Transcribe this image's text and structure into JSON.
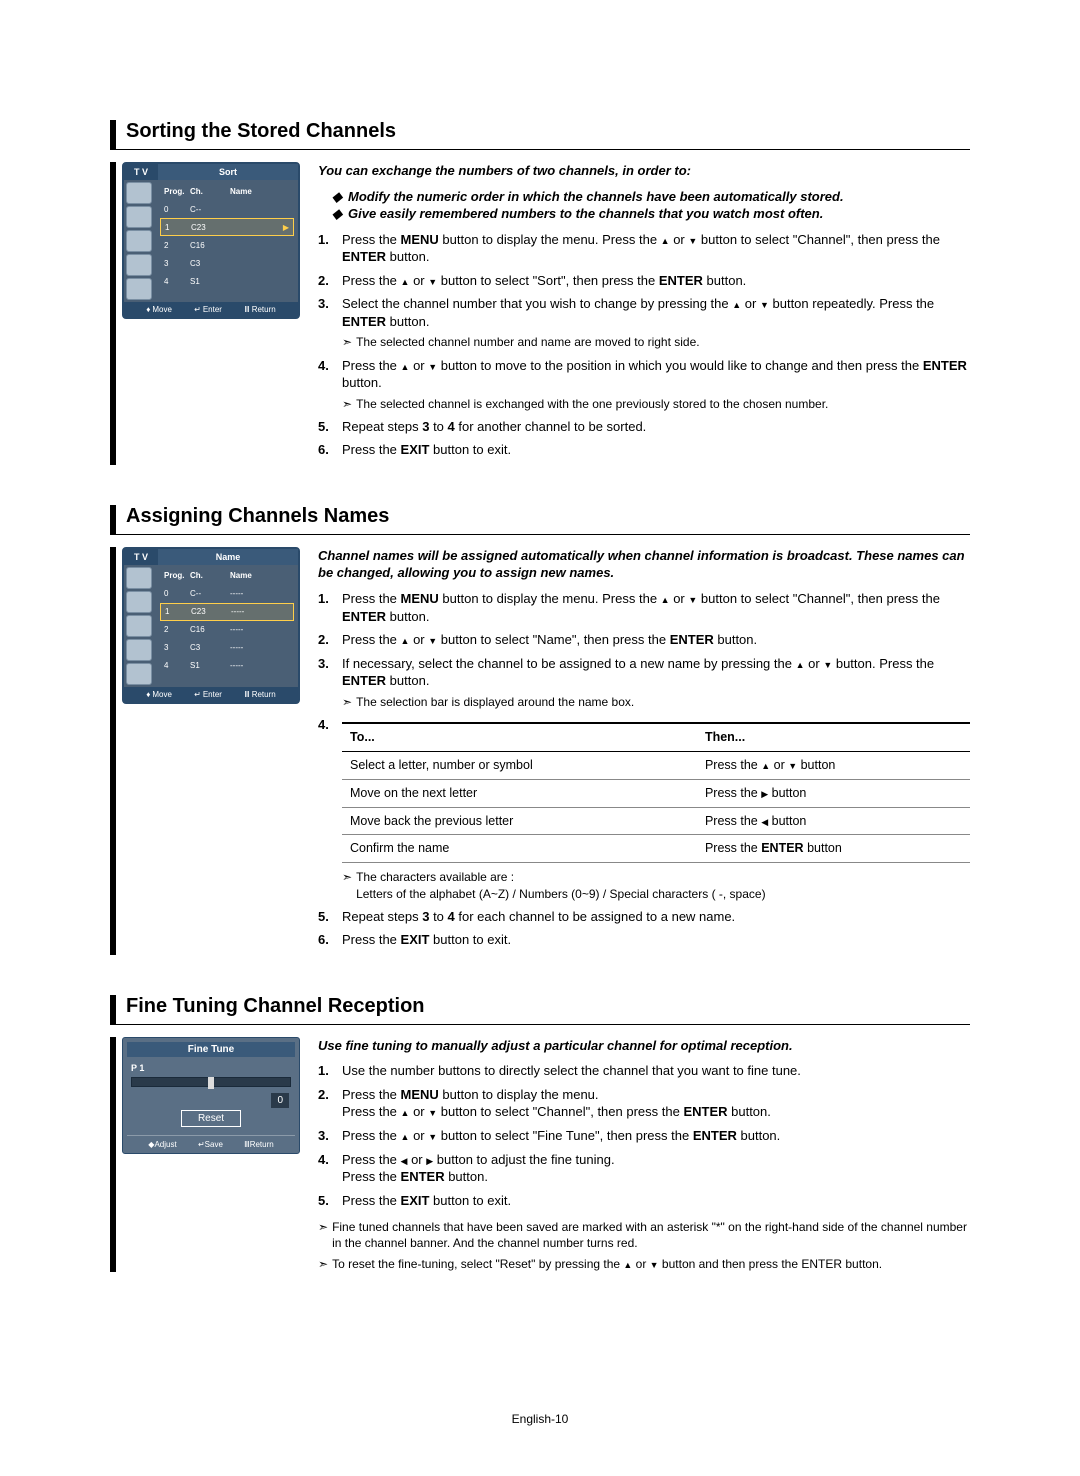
{
  "footer": "English-10",
  "section1": {
    "title": "Sorting the Stored Channels",
    "osd": {
      "tv": "T V",
      "title": "Sort",
      "head": {
        "prog": "Prog.",
        "ch": "Ch.",
        "name": "Name"
      },
      "rows": [
        {
          "p": "0",
          "c": "C--",
          "n": ""
        },
        {
          "p": "1",
          "c": "C23",
          "n": ""
        },
        {
          "p": "2",
          "c": "C16",
          "n": ""
        },
        {
          "p": "3",
          "c": "C3",
          "n": ""
        },
        {
          "p": "4",
          "c": "S1",
          "n": ""
        }
      ],
      "foot": {
        "move": "Move",
        "enter": "Enter",
        "ret": "Return"
      }
    },
    "intro": "You can exchange the numbers of two channels, in order to:",
    "b1": "Modify the numeric order in which the channels have been automatically stored.",
    "b2": "Give easily remembered numbers to the channels that you watch most often.",
    "s1a": "Press the ",
    "s1b": "MENU",
    "s1c": " button to display the menu.  Press the ",
    "s1d": " or ",
    "s1e": " button to select \"Channel\", then press the ",
    "s1f": "ENTER",
    "s1g": " button.",
    "s2a": "Press the ",
    "s2b": " or ",
    "s2c": " button to select \"Sort\", then press the ",
    "s2d": "ENTER",
    "s2e": " button.",
    "s3a": "Select the channel number that you wish to change by pressing the ",
    "s3b": " or ",
    "s3c": " button repeatedly. Press the ",
    "s3d": "ENTER",
    "s3e": " button.",
    "s3note": "The selected channel number and name are moved to right side.",
    "s4a": "Press the ",
    "s4b": " or ",
    "s4c": " button to move to the position in which you would like to change and then press the  ",
    "s4d": "ENTER",
    "s4e": " button.",
    "s4note": "The selected channel is exchanged with the one previously stored to the chosen number.",
    "s5a": "Repeat steps ",
    "s5b": "3",
    "s5c": " to ",
    "s5d": "4",
    "s5e": " for another channel to be sorted.",
    "s6a": "Press the ",
    "s6b": "EXIT",
    "s6c": " button to exit."
  },
  "section2": {
    "title": "Assigning Channels Names",
    "osd": {
      "tv": "T V",
      "title": "Name",
      "head": {
        "prog": "Prog.",
        "ch": "Ch.",
        "name": "Name"
      },
      "rows": [
        {
          "p": "0",
          "c": "C--",
          "n": "-----"
        },
        {
          "p": "1",
          "c": "C23",
          "n": "-----"
        },
        {
          "p": "2",
          "c": "C16",
          "n": "-----"
        },
        {
          "p": "3",
          "c": "C3",
          "n": "-----"
        },
        {
          "p": "4",
          "c": "S1",
          "n": "-----"
        }
      ],
      "foot": {
        "move": "Move",
        "enter": "Enter",
        "ret": "Return"
      }
    },
    "intro": "Channel names will be assigned automatically when channel information is broadcast. These names can be changed, allowing you to assign new names.",
    "s1a": "Press the ",
    "s1b": "MENU",
    "s1c": " button to display the menu.  Press the ",
    "s1d": " or ",
    "s1e": " button to select \"Channel\", then press the ",
    "s1f": "ENTER",
    "s1g": " button.",
    "s2a": "Press the ",
    "s2b": " or ",
    "s2c": " button to select \"Name\", then press the ",
    "s2d": "ENTER",
    "s2e": " button.",
    "s3a": "If necessary, select the channel to be assigned to a new name by pressing the ",
    "s3b": " or ",
    "s3c": " button. Press the ",
    "s3d": "ENTER",
    "s3e": " button.",
    "s3note": "The selection bar is displayed around the name box.",
    "table": {
      "hTo": "To...",
      "hThen": "Then...",
      "r1t": "Select a letter, number or symbol",
      "r1h_a": "Press the ",
      "r1h_b": " or ",
      "r1h_c": " button",
      "r2t": "Move on the next letter",
      "r2h_a": "Press the  ",
      "r2h_b": " button",
      "r3t": "Move back the previous letter",
      "r3h_a": "Press the  ",
      "r3h_b": " button",
      "r4t": "Confirm the name",
      "r4h_a": "Press the ",
      "r4h_b": "ENTER",
      "r4h_c": " button"
    },
    "note_a": "The characters available are :",
    "note_b": "Letters of the alphabet (A~Z) / Numbers (0~9) / Special characters ( -, space)",
    "s5a": "Repeat steps ",
    "s5b": "3",
    "s5c": " to ",
    "s5d": "4",
    "s5e": " for each channel to be assigned to a new name.",
    "s6a": "Press the ",
    "s6b": "EXIT",
    "s6c": " button to exit."
  },
  "section3": {
    "title": "Fine Tuning Channel Reception",
    "osd": {
      "title": "Fine Tune",
      "p": "P  1",
      "val": "0",
      "reset": "Reset",
      "foot": {
        "adj": "Adjust",
        "save": "Save",
        "ret": "Return"
      }
    },
    "intro": "Use fine tuning to manually adjust a particular channel for optimal reception.",
    "s1": "Use the number buttons to directly select the channel that you want to fine tune.",
    "s2a": "Press the ",
    "s2b": "MENU",
    "s2c": " button to display the menu.",
    "s2d": "Press the ",
    "s2e": " or ",
    "s2f": " button to select \"Channel\", then press the ",
    "s2g": "ENTER",
    "s2h": " button.",
    "s3a": "Press the ",
    "s3b": " or ",
    "s3c": " button to select \"Fine Tune\", then press the ",
    "s3d": "ENTER",
    "s3e": " button.",
    "s4a": "Press the  ",
    "s4b": " or  ",
    "s4c": " button to adjust the fine tuning.",
    "s4d": "Press the ",
    "s4e": "ENTER",
    "s4f": " button.",
    "s5a": "Press the ",
    "s5b": "EXIT",
    "s5c": " button to exit.",
    "n1": "Fine tuned channels that have been saved are marked with an asterisk \"*\" on the right-hand side of the channel number in the channel banner.  And the channel number turns red.",
    "n2a": "To reset the fine-tuning, select \"Reset\" by pressing the ",
    "n2b": " or ",
    "n2c": " button and then press the ",
    "n2d": "ENTER",
    "n2e": " button."
  }
}
